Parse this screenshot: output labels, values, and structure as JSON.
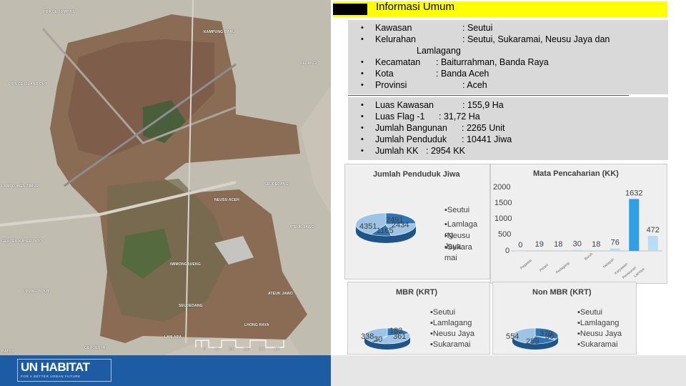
{
  "header": {
    "title": "Informasi Umum"
  },
  "info_top": [
    {
      "label": "Kawasan",
      "value": ": Seutui"
    },
    {
      "label": "Kelurahan",
      "value": ": Seutui, Sukaramai, Neusu Jaya dan",
      "cont": "Lamlagang"
    },
    {
      "label": "Kecamatan",
      "value": ": Baiturrahman, Banda Raya"
    },
    {
      "label": "Kota",
      "value": ": Banda Aceh"
    },
    {
      "label": "Provinsi",
      "value": ": Aceh"
    }
  ],
  "info_bottom": [
    {
      "label": "Luas Kawasan",
      "value": ": 155,9 Ha"
    },
    {
      "label": "Luas Flag -1",
      "value": ": 31,72 Ha"
    },
    {
      "label": "Jumlah Bangunan",
      "value": ": 2265 Unit"
    },
    {
      "label": "Jumlah Penduduk",
      "value": ": 10441 Jiwa"
    },
    {
      "label": "Jumlah KK",
      "value": ": 2954 KK"
    }
  ],
  "map": {
    "places": [
      "PRINCE JUMPING",
      "KAMPUNG BARU",
      "PELANGI",
      "PRINCE ISLAND CUT",
      "LAMPLUMEN TIMUR",
      "NEUSU ACEH",
      "SEUDEDANG",
      "GEUCEU KAYEE JATO",
      "ATEUK JAWO",
      "IMIMONGBUENG",
      "ATEUK JAWO",
      "UDONG BUKIT",
      "SEUDEDANG",
      "LHONG RAYA",
      "LAM ARA",
      "GEUCEU IH",
      "BATOH"
    ],
    "scale": [
      "0",
      "50",
      "100",
      "200",
      "300",
      "400"
    ]
  },
  "footer": {
    "logo_main": "UN HABITAT",
    "logo_sub": "FOR A BETTER URBAN FUTURE"
  },
  "legend_kelurahan": [
    "Seutui",
    "Lamlagang",
    "Neusu Jaya",
    "Sukaramai"
  ],
  "legend_wrapped": [
    "Seutui",
    "Lamlaga ng",
    "Neusu Jaya",
    "Sukara mai"
  ],
  "colors": {
    "pie_blue": "#2e75b6",
    "pie_light": "#9dc3e6",
    "bar_light": "#b9dcf5",
    "bar_blue": "#2f9fe8",
    "title_bar": "#ffff00",
    "panel": "#efefef",
    "info_bg": "#d9d9d9",
    "footer_blue": "#1d5ba3"
  },
  "chart_data": [
    {
      "type": "pie",
      "title": "Jumlah Penduduk Jiwa",
      "categories": [
        "Seutui",
        "Lamlagang",
        "Neusu Jaya",
        "Sukaramai"
      ],
      "values": [
        2491,
        2434,
        1165,
        4351
      ]
    },
    {
      "type": "bar",
      "title": "Mata Pencaharian (KK)",
      "categories": [
        "Pegawai",
        "Petani",
        "Pedagang",
        "Buruh",
        "Nelayan",
        "Karyawan",
        "Pensiunan",
        "Lainnya"
      ],
      "values": [
        0,
        19,
        18,
        30,
        18,
        76,
        1632,
        472
      ],
      "ylim": [
        0,
        2000
      ],
      "yticks": [
        0,
        500,
        1000,
        1500,
        2000
      ]
    },
    {
      "type": "pie",
      "title": "MBR (KRT)",
      "categories": [
        "Seutui",
        "Lamlagang",
        "Neusu Jaya",
        "Sukaramai"
      ],
      "values": [
        183,
        361,
        30,
        338
      ]
    },
    {
      "type": "pie",
      "title": "Non MBR (KRT)",
      "categories": [
        "Seutui",
        "Lamlagang",
        "Neusu Jaya",
        "Sukaramai"
      ],
      "values": [
        379,
        30,
        259,
        554
      ]
    }
  ]
}
